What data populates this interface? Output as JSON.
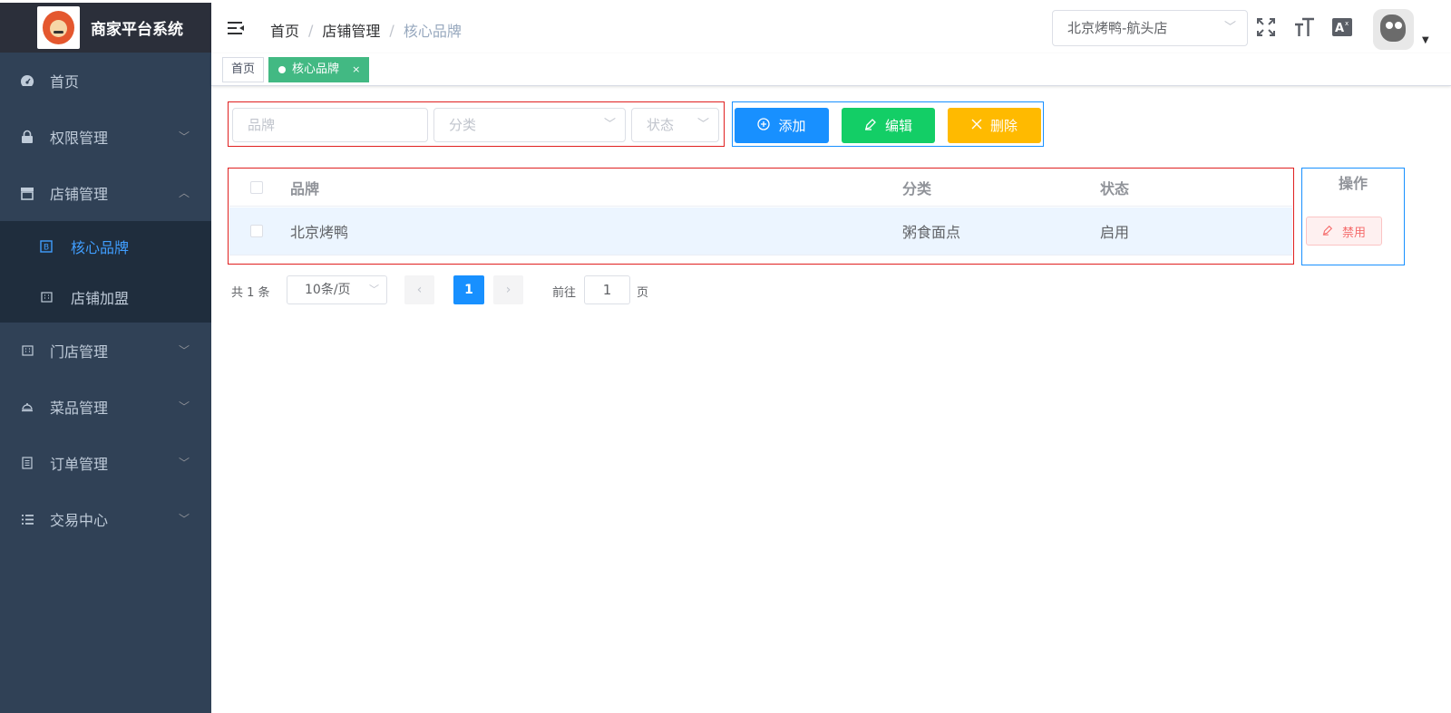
{
  "app": {
    "title": "商家平台系统"
  },
  "sidebar": {
    "items": [
      {
        "label": "首页",
        "icon": "dashboard-icon"
      },
      {
        "label": "权限管理",
        "icon": "lock-icon"
      },
      {
        "label": "店铺管理",
        "icon": "shop-icon"
      },
      {
        "label": "门店管理",
        "icon": "building-icon"
      },
      {
        "label": "菜品管理",
        "icon": "dish-icon"
      },
      {
        "label": "订单管理",
        "icon": "document-icon"
      },
      {
        "label": "交易中心",
        "icon": "list-icon"
      }
    ],
    "shop_submenu": [
      {
        "label": "核心品牌",
        "icon": "brand-icon",
        "active": true
      },
      {
        "label": "店铺加盟",
        "icon": "building-icon"
      }
    ]
  },
  "header": {
    "breadcrumb": [
      "首页",
      "店铺管理",
      "核心品牌"
    ],
    "store_select": "北京烤鸭-航头店"
  },
  "tags": [
    {
      "label": "首页"
    },
    {
      "label": "核心品牌",
      "active": true,
      "close": "×"
    }
  ],
  "filters": {
    "brand_placeholder": "品牌",
    "category_placeholder": "分类",
    "status_placeholder": "状态"
  },
  "toolbar": {
    "add_label": "添加",
    "edit_label": "编辑",
    "delete_label": "删除",
    "colors": {
      "add": "#1890ff",
      "edit": "#13ce66",
      "delete": "#ffba00"
    }
  },
  "table": {
    "columns": [
      "品牌",
      "分类",
      "状态",
      "操作"
    ],
    "rows": [
      {
        "brand": "北京烤鸭",
        "category": "粥食面点",
        "status": "启用",
        "action": "禁用"
      }
    ]
  },
  "pagination": {
    "total_text": "共 1 条",
    "page_size": "10条/页",
    "current_page": "1",
    "goto_label": "前往",
    "goto_value": "1",
    "page_suffix": "页"
  }
}
